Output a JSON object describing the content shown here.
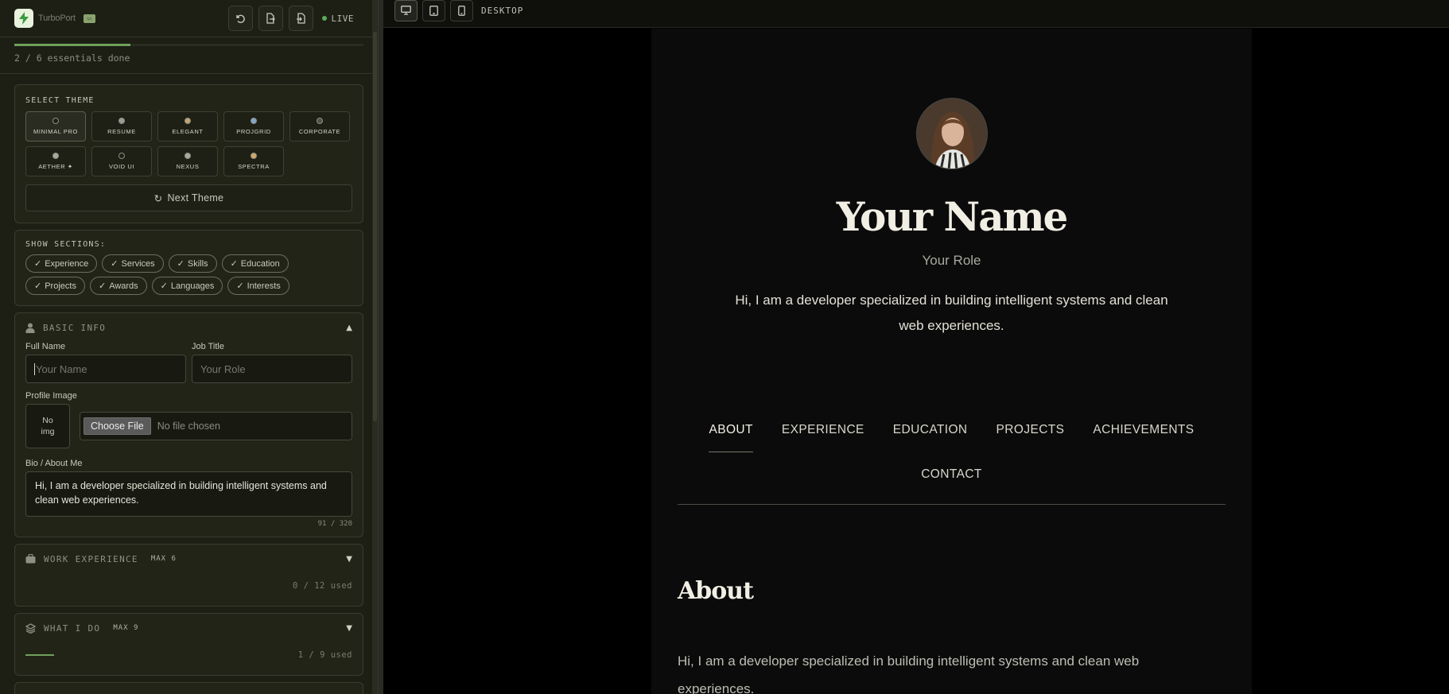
{
  "app": {
    "brand": "TurboPort",
    "live_label": "LIVE",
    "colors": {
      "accent_green": "#6fa15a",
      "sidebar_bg": "#1d1f15",
      "preview_bg": "#0b0b0b"
    }
  },
  "progress": {
    "text": "2 / 6 essentials done",
    "fraction": 0.333
  },
  "theme": {
    "label": "SELECT THEME",
    "options": [
      {
        "name": "MINIMAL PRO",
        "dot": "#1e2016",
        "active": true
      },
      {
        "name": "RESUME",
        "dot": "#9a9a98",
        "active": false
      },
      {
        "name": "ELEGANT",
        "dot": "#c3a572",
        "active": false
      },
      {
        "name": "PROJGRID",
        "dot": "#7fa6c9",
        "active": false
      },
      {
        "name": "CORPORATE",
        "dot": "#505248",
        "active": false
      },
      {
        "name": "AETHER ✦",
        "dot": "#a8a8a2",
        "active": false
      },
      {
        "name": "VOID UI",
        "dot": "#1e2016",
        "active": false
      },
      {
        "name": "NEXUS",
        "dot": "#a8a8a2",
        "active": false
      },
      {
        "name": "SPECTRA",
        "dot": "#d0a86e",
        "active": false
      }
    ],
    "next_label": "Next Theme"
  },
  "sections": {
    "label": "SHOW SECTIONS:",
    "chips": [
      "Experience",
      "Services",
      "Skills",
      "Education",
      "Projects",
      "Awards",
      "Languages",
      "Interests"
    ]
  },
  "basic_info": {
    "title": "BASIC INFO",
    "full_name_label": "Full Name",
    "full_name_placeholder": "Your Name",
    "job_title_label": "Job Title",
    "job_title_placeholder": "Your Role",
    "profile_image_label": "Profile Image",
    "no_img_line1": "No",
    "no_img_line2": "img",
    "file_button": "Choose File",
    "file_status": "No file chosen",
    "bio_label": "Bio / About Me",
    "bio_value": "Hi, I am a developer specialized in building intelligent systems and clean web experiences.",
    "bio_counter": "91 / 320"
  },
  "work_experience": {
    "title": "WORK EXPERIENCE",
    "max": "MAX 6",
    "used": "0 / 12 used",
    "fraction": 0
  },
  "what_i_do": {
    "title": "WHAT I DO",
    "max": "MAX 9",
    "used": "1 / 9 used",
    "fraction": 0.111
  },
  "preview": {
    "device_label": "DESKTOP",
    "name": "Your Name",
    "role": "Your Role",
    "bio": "Hi, I am a developer specialized in building intelligent systems and clean web experiences.",
    "nav": [
      "ABOUT",
      "EXPERIENCE",
      "EDUCATION",
      "PROJECTS",
      "ACHIEVEMENTS"
    ],
    "nav_contact": "CONTACT",
    "about_title": "About",
    "about_body": "Hi, I am a developer specialized in building intelligent systems and clean web experiences."
  }
}
